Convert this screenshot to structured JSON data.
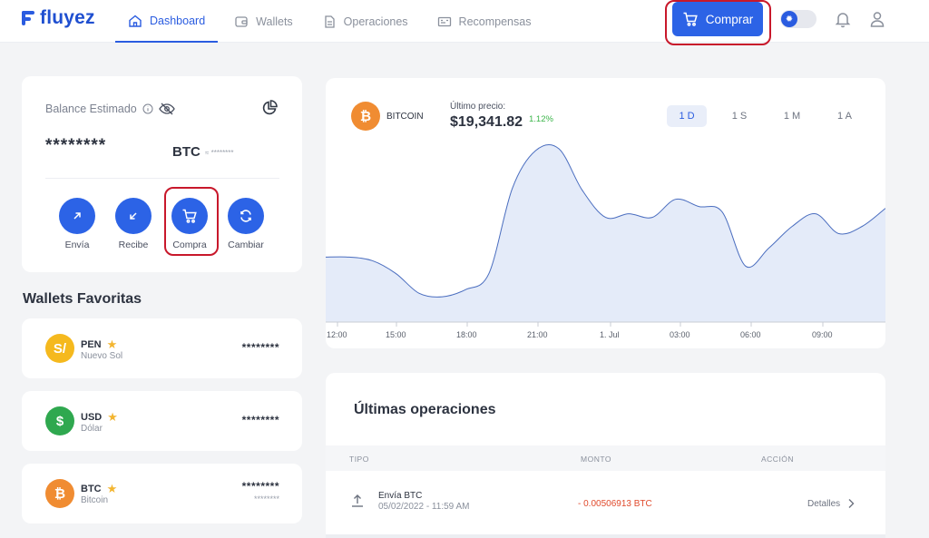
{
  "brand": {
    "name": "fluyez",
    "color": "#2a5ce0"
  },
  "nav": {
    "items": [
      {
        "label": "Dashboard",
        "icon": "home-icon",
        "active": true
      },
      {
        "label": "Wallets",
        "icon": "wallet-icon",
        "active": false
      },
      {
        "label": "Operaciones",
        "icon": "document-icon",
        "active": false
      },
      {
        "label": "Recompensas",
        "icon": "rewards-icon",
        "active": false
      }
    ],
    "buy_label": "Comprar"
  },
  "balance": {
    "label": "Balance Estimado",
    "value": "********",
    "currency": "BTC",
    "sub_value": "≈ ********",
    "actions": [
      {
        "label": "Envía",
        "icon": "arrow-up-right-icon"
      },
      {
        "label": "Recibe",
        "icon": "arrow-down-left-icon"
      },
      {
        "label": "Compra",
        "icon": "cart-icon"
      },
      {
        "label": "Cambiar",
        "icon": "exchange-icon"
      }
    ]
  },
  "favorites": {
    "title": "Wallets Favoritas",
    "wallets": [
      {
        "code": "PEN",
        "name": "Nuevo Sol",
        "amount": "********",
        "sub_amount": "",
        "symbol": "S/",
        "color": "#f5b91e"
      },
      {
        "code": "USD",
        "name": "Dólar",
        "amount": "********",
        "sub_amount": "",
        "symbol": "$",
        "color": "#2fa84f"
      },
      {
        "code": "BTC",
        "name": "Bitcoin",
        "amount": "********",
        "sub_amount": "********",
        "symbol": "₿",
        "color": "#f08c32"
      }
    ]
  },
  "market": {
    "coin": "BITCOIN",
    "coin_symbol": "₿",
    "last_price_label": "Último precio:",
    "last_price": "$19,341.82",
    "change": "1.12%",
    "ranges": [
      {
        "label": "1 D",
        "active": true
      },
      {
        "label": "1 S",
        "active": false
      },
      {
        "label": "1 M",
        "active": false
      },
      {
        "label": "1 A",
        "active": false
      }
    ]
  },
  "chart_data": {
    "type": "area",
    "x_ticks": [
      "12:00",
      "15:00",
      "18:00",
      "21:00",
      "1. Jul",
      "03:00",
      "06:00",
      "09:00"
    ],
    "values": [
      0.36,
      0.36,
      0.34,
      0.27,
      0.16,
      0.14,
      0.18,
      0.27,
      0.74,
      0.95,
      0.96,
      0.73,
      0.58,
      0.6,
      0.58,
      0.68,
      0.64,
      0.61,
      0.31,
      0.41,
      0.53,
      0.6,
      0.49,
      0.53,
      0.63
    ],
    "line_color": "#4a6dbf",
    "fill_color": "#e4ebf9",
    "grid": false
  },
  "operations": {
    "title": "Últimas operaciones",
    "columns": [
      "TIPO",
      "MONTO",
      "ACCIÓN"
    ],
    "rows": [
      {
        "title": "Envía BTC",
        "date": "05/02/2022 - 11:59 AM",
        "amount": "- 0.00506913 BTC",
        "action": "Detalles"
      }
    ]
  }
}
